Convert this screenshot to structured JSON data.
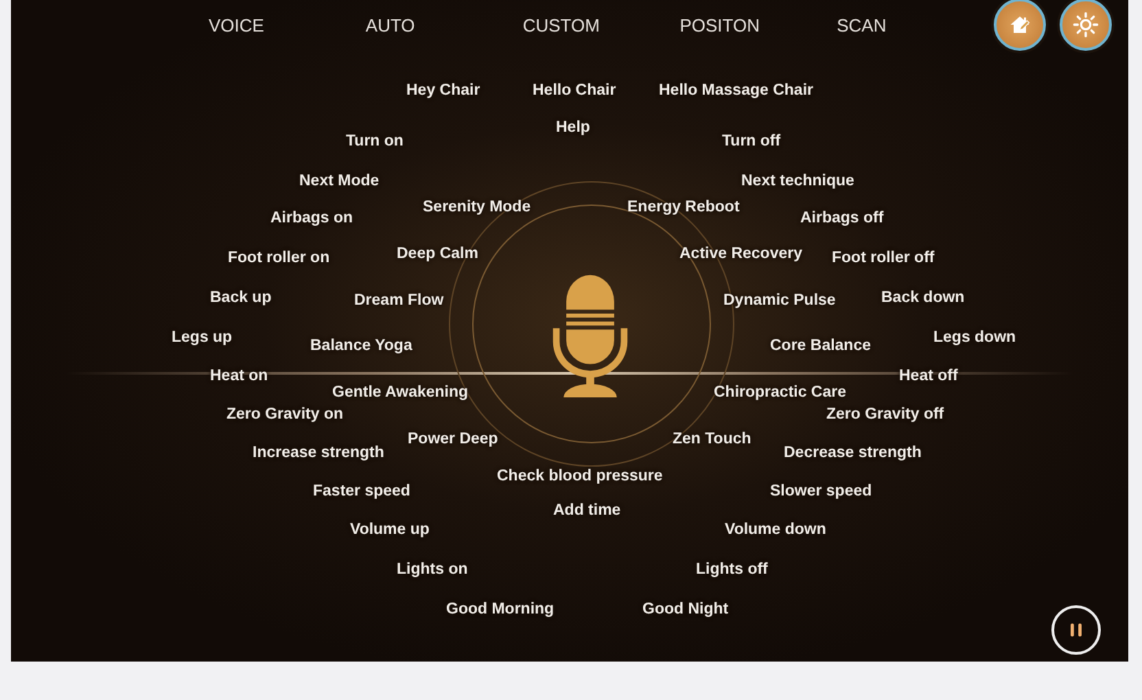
{
  "tabs": [
    {
      "label": "VOICE"
    },
    {
      "label": "AUTO"
    },
    {
      "label": "CUSTOM"
    },
    {
      "label": "POSITON"
    },
    {
      "label": "SCAN"
    }
  ],
  "commands": [
    "Hey Chair",
    "Hello Chair",
    "Hello Massage Chair",
    "Help",
    "Turn on",
    "Turn off",
    "Next Mode",
    "Next technique",
    "Airbags on",
    "Serenity Mode",
    "Energy Reboot",
    "Airbags off",
    "Foot roller on",
    "Deep Calm",
    "Active Recovery",
    "Foot roller off",
    "Back up",
    "Dream Flow",
    "Dynamic Pulse",
    "Back down",
    "Legs up",
    "Balance Yoga",
    "Core Balance",
    "Legs down",
    "Heat on",
    "Heat off",
    "Gentle Awakening",
    "Chiropractic Care",
    "Zero Gravity on",
    "Zero Gravity off",
    "Power Deep",
    "Zen Touch",
    "Increase strength",
    "Decrease strength",
    "Check blood pressure",
    "Faster speed",
    "Slower speed",
    "Add time",
    "Volume up",
    "Volume down",
    "Lights on",
    "Lights off",
    "Good Morning",
    "Good Night"
  ]
}
